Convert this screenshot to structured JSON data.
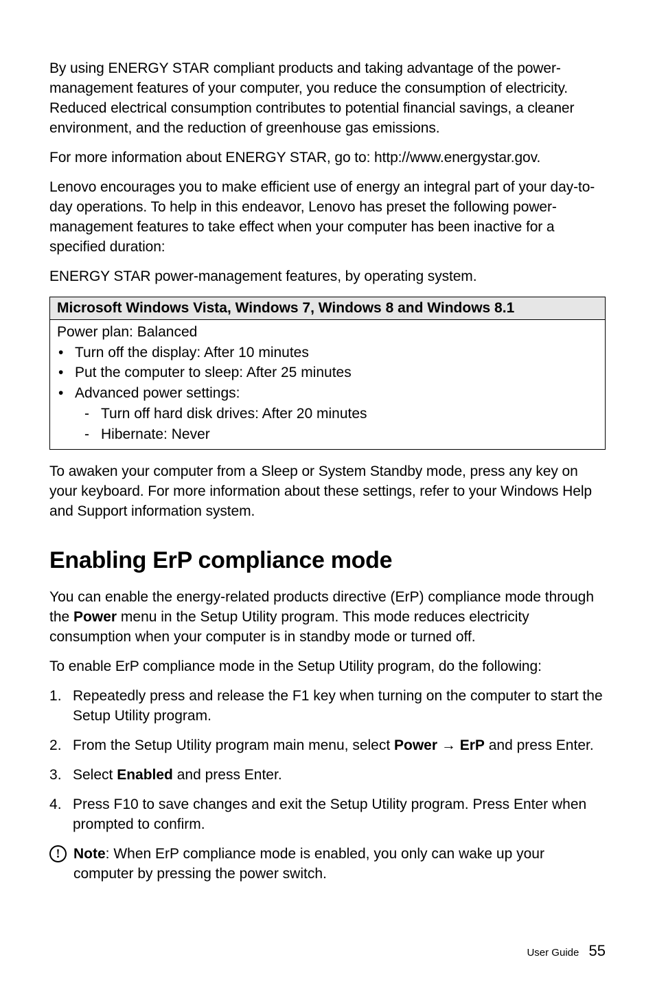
{
  "paragraphs": {
    "p1": "By using ENERGY STAR compliant products and taking advantage of the power-management features of your computer, you reduce the consumption of electricity. Reduced electrical consumption contributes to potential financial savings, a cleaner environment, and the reduction of greenhouse gas emissions.",
    "p2": "For more information about ENERGY STAR, go to: http://www.energystar.gov.",
    "p3": "Lenovo encourages you to make efficient use of energy an integral part of your day-to-day operations. To help in this endeavor, Lenovo has preset the following power-management features to take effect when your computer has been inactive for a specified duration:",
    "p4": "ENERGY STAR power-management features, by operating system.",
    "p5": "To awaken your computer from a Sleep or System Standby mode, press any key on your keyboard. For more information about these settings, refer to your Windows Help and Support information system."
  },
  "table": {
    "header": "Microsoft Windows Vista, Windows 7, Windows 8 and Windows 8.1",
    "plan": "Power plan: Balanced",
    "items": {
      "display": "Turn off the display: After 10 minutes",
      "sleep": "Put the computer to sleep: After 25 minutes",
      "advanced": "Advanced power settings:",
      "hdd": "Turn off hard disk drives: After 20 minutes",
      "hibernate": "Hibernate: Never"
    }
  },
  "heading": "Enabling ErP compliance mode",
  "erp": {
    "intro_pre": "You can enable the energy-related products directive (ErP) compliance mode through the ",
    "intro_bold": "Power",
    "intro_post": " menu in the Setup Utility program. This mode reduces electricity consumption when your computer is in standby mode or turned off.",
    "lead": "To enable ErP compliance mode in the Setup Utility program, do the following:",
    "step1": "Repeatedly press and release the F1 key when turning on the computer to start the Setup Utility program.",
    "step2_pre": "From the Setup Utility program main menu, select ",
    "step2_b1": "Power",
    "step2_arrow": " → ",
    "step2_b2": "ErP",
    "step2_post": " and press Enter.",
    "step3_pre": "Select ",
    "step3_bold": "Enabled",
    "step3_post": " and press Enter.",
    "step4": "Press F10 to save changes and exit the Setup Utility program. Press Enter when prompted to confirm."
  },
  "note": {
    "label": "Note",
    "text": ": When ErP compliance mode is enabled, you only can wake up your computer by pressing the power switch."
  },
  "footer": {
    "label": "User Guide",
    "page": "55"
  }
}
